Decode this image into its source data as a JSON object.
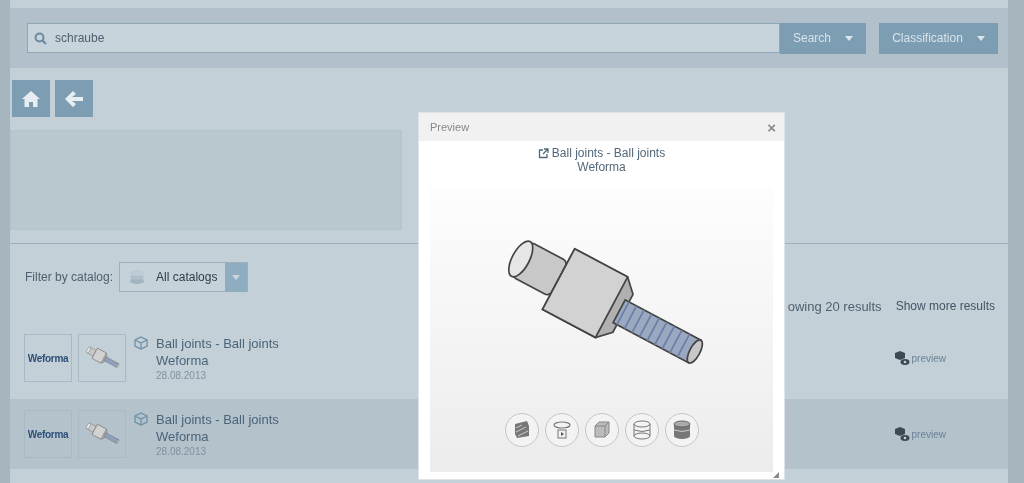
{
  "search": {
    "value": "schraube",
    "button": "Search",
    "classification": "Classification"
  },
  "filter": {
    "label": "Filter by catalog:",
    "value": "All catalogs"
  },
  "results_summary": {
    "count": "owing 20 results",
    "more": "Show more results"
  },
  "results": [
    {
      "logo": "Weforma",
      "title": "Ball joints - Ball joints",
      "vendor": "Weforma",
      "date": "28.08.2013",
      "action": "preview",
      "selected": false
    },
    {
      "logo": "Weforma",
      "title": "Ball joints - Ball joints",
      "vendor": "Weforma",
      "date": "28.08.2013",
      "action": "preview",
      "selected": true
    }
  ],
  "preview_dialog": {
    "title": "Preview",
    "close": "×",
    "link_title": "Ball joints - Ball joints",
    "link_vendor": "Weforma",
    "tools": [
      {
        "kind": "hatched"
      },
      {
        "kind": "rotate"
      },
      {
        "kind": "cube"
      },
      {
        "kind": "wireframe"
      },
      {
        "kind": "shaded"
      }
    ]
  }
}
